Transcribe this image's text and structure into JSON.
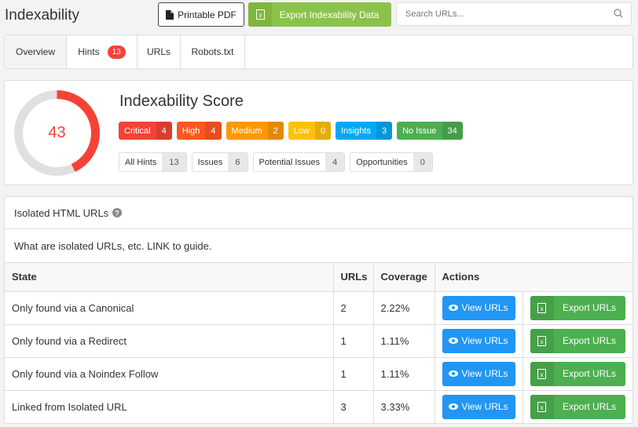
{
  "header": {
    "title": "Indexability",
    "pdf_label": "Printable PDF",
    "export_label": "Export Indexability Data",
    "search_placeholder": "Search URLs..."
  },
  "tabs": [
    {
      "label": "Overview",
      "active": true
    },
    {
      "label": "Hints",
      "badge": "13"
    },
    {
      "label": "URLs"
    },
    {
      "label": "Robots.txt"
    }
  ],
  "score": {
    "title": "Indexability Score",
    "value": "43",
    "percent": 43,
    "severities": [
      {
        "label": "Critical",
        "count": "4",
        "color": "#f44336"
      },
      {
        "label": "High",
        "count": "4",
        "color": "#ff5722"
      },
      {
        "label": "Medium",
        "count": "2",
        "color": "#ff9800"
      },
      {
        "label": "Low",
        "count": "0",
        "color": "#ffc107"
      },
      {
        "label": "Insights",
        "count": "3",
        "color": "#03a9f4"
      },
      {
        "label": "No Issue",
        "count": "34",
        "color": "#4caf50"
      }
    ],
    "categories": [
      {
        "label": "All Hints",
        "count": "13"
      },
      {
        "label": "Issues",
        "count": "6"
      },
      {
        "label": "Potential Issues",
        "count": "4"
      },
      {
        "label": "Opportunities",
        "count": "0"
      }
    ]
  },
  "isolated": {
    "title": "Isolated HTML URLs",
    "description": "What are isolated URLs, etc. LINK to guide.",
    "columns": [
      "State",
      "URLs",
      "Coverage",
      "Actions"
    ],
    "view_label": "View URLs",
    "export_label": "Export URLs",
    "rows": [
      {
        "state": "Only found via a Canonical",
        "urls": "2",
        "coverage": "2.22%"
      },
      {
        "state": "Only found via a Redirect",
        "urls": "1",
        "coverage": "1.11%"
      },
      {
        "state": "Only found via a Noindex Follow",
        "urls": "1",
        "coverage": "1.11%"
      },
      {
        "state": "Linked from Isolated URL",
        "urls": "3",
        "coverage": "3.33%"
      }
    ]
  }
}
